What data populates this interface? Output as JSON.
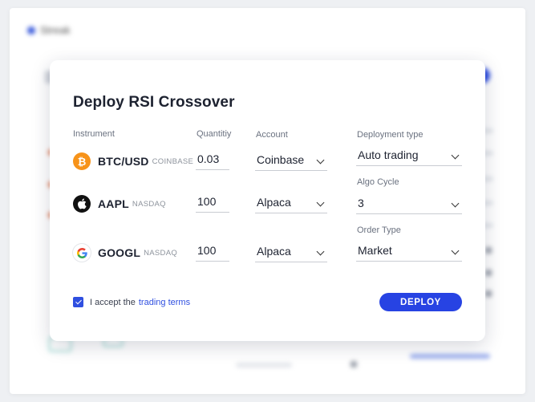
{
  "background": {
    "app_name": "Streak"
  },
  "modal": {
    "title": "Deploy RSI Crossover",
    "columns": {
      "instrument": "Instrument",
      "quantity": "Quantitiy",
      "account": "Account",
      "deployment_type": "Deployment type"
    },
    "rows": [
      {
        "symbol": "BTC/USD",
        "exchange": "COINBASE",
        "icon": "bitcoin-icon",
        "quantity": "0.03",
        "account": "Coinbase"
      },
      {
        "symbol": "AAPL",
        "exchange": "NASDAQ",
        "icon": "apple-icon",
        "quantity": "100",
        "account": "Alpaca"
      },
      {
        "symbol": "GOOGL",
        "exchange": "NASDAQ",
        "icon": "google-icon",
        "quantity": "100",
        "account": "Alpaca"
      }
    ],
    "deployment_type": "Auto trading",
    "algo_cycle_label": "Algo Cycle",
    "algo_cycle": "3",
    "order_type_label": "Order Type",
    "order_type": "Market",
    "terms": {
      "prefix": "I accept the",
      "link": "trading terms",
      "checked": true
    },
    "deploy_label": "DEPLOY"
  },
  "colors": {
    "accent": "#2743e3",
    "bitcoin": "#f7931a"
  }
}
